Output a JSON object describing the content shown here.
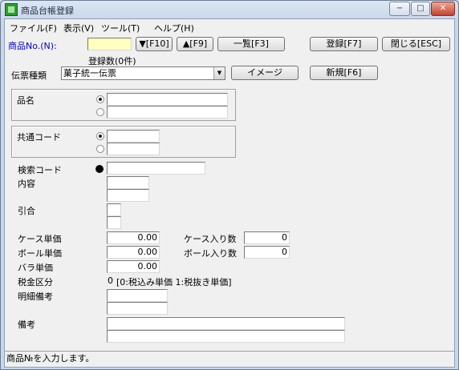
{
  "window": {
    "title": "商品台帳登録",
    "controls": {
      "minimize": "−",
      "maximize": "□",
      "close": "✕"
    }
  },
  "menu": [
    "ファイル(F)",
    "表示(V)",
    "ツール(T)",
    "ヘルプ(H)"
  ],
  "toolbar": {
    "product_no_label": "商品No.(N):",
    "product_no_value": "",
    "prev_label": "▼[F10]",
    "next_label": "▲[F9]",
    "list_label": "一覧[F3]",
    "register_label": "登録[F7]",
    "close_label": "閉じる[ESC]",
    "count_label": "登録数(0件)",
    "slip_type_label": "伝票種類",
    "slip_type_value": "菓子統一伝票",
    "image_label": "イメージ",
    "new_label": "新規[F6]"
  },
  "form": {
    "product_name_label": "品名",
    "common_code_label": "共通コード",
    "search_code_label": "検索コード",
    "contents_label": "内容",
    "pull_label": "引合",
    "case_price_label": "ケース単価",
    "case_price_value": "0.00",
    "case_qty_label": "ケース入り数",
    "case_qty_value": "0",
    "ball_price_label": "ボール単価",
    "ball_price_value": "0.00",
    "ball_qty_label": "ボール入り数",
    "ball_qty_value": "0",
    "loose_price_label": "バラ単価",
    "loose_price_value": "0.00",
    "tax_label": "税金区分",
    "tax_value": "0",
    "tax_hint": "[0:税込み単価 1:税抜き単価]",
    "detail_note_label": "明細備考",
    "note_label": "備考"
  },
  "status": {
    "message": "商品№を入力します。"
  },
  "icons": {
    "radio_selected": "radio-selected-icon",
    "bullet": "bullet-icon",
    "dropdown": "dropdown-arrow-icon"
  }
}
